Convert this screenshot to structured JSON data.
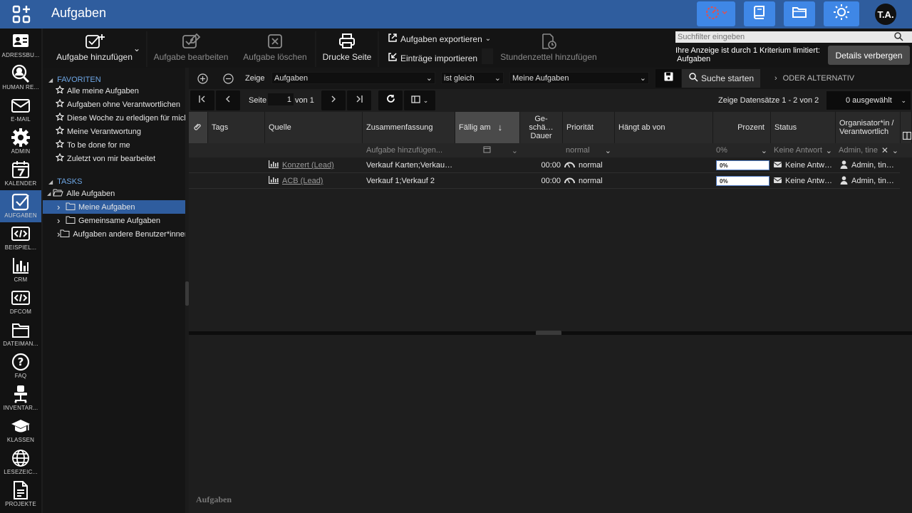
{
  "app": {
    "title": "Aufgaben",
    "user_initials": "T.A."
  },
  "topbar_icons": [
    "apps-grid-icon",
    "stopwatch-icon",
    "book-icon",
    "folder-icon",
    "brightness-icon"
  ],
  "nav": [
    {
      "label": "ADRESSBU...",
      "icon": "addressbook-icon"
    },
    {
      "label": "HUMAN RE...",
      "icon": "person-search-icon"
    },
    {
      "label": "E-MAIL",
      "icon": "mail-icon"
    },
    {
      "label": "ADMIN",
      "icon": "gear-icon"
    },
    {
      "label": "KALENDER",
      "icon": "calendar-icon"
    },
    {
      "label": "AUFGABEN",
      "icon": "task-check-icon",
      "active": true
    },
    {
      "label": "BEISPIEL...",
      "icon": "code-icon"
    },
    {
      "label": "CRM",
      "icon": "bar-chart-icon"
    },
    {
      "label": "DFCOM",
      "icon": "code-icon"
    },
    {
      "label": "DATEIMAN...",
      "icon": "folder-icon"
    },
    {
      "label": "FAQ",
      "icon": "question-icon"
    },
    {
      "label": "INVENTAR...",
      "icon": "chair-icon"
    },
    {
      "label": "KLASSEN",
      "icon": "graduation-cap-icon"
    },
    {
      "label": "LESEZEIC...",
      "icon": "globe-icon"
    },
    {
      "label": "PROJEKTE",
      "icon": "document-icon"
    }
  ],
  "toolbar": {
    "add": "Aufgabe hinzufügen",
    "edit": "Aufgabe bearbeiten",
    "delete": "Aufgabe löschen",
    "print": "Drucke Seite",
    "export": "Aufgaben exportieren",
    "import": "Einträge importieren",
    "timesheet": "Stundenzettel hinzufügen"
  },
  "search": {
    "placeholder": "Suchfilter eingeben",
    "note": "Ihre Anzeige ist durch 1 Kriterium limitiert:",
    "note_sub": "Aufgaben",
    "details_button": "Details verbergen"
  },
  "tree": {
    "favorites_header": "FAVORITEN",
    "favorites": [
      "Alle meine Aufgaben",
      "Aufgaben ohne Verantwortlichen",
      "Diese Woche zu erledigen für mich",
      "Meine Verantwortung",
      "To be done for me",
      "Zuletzt von mir bearbeitet"
    ],
    "tasks_header": "TASKS",
    "root": "Alle Aufgaben",
    "folders": [
      "Meine Aufgaben",
      "Gemeinsame Aufgaben",
      "Aufgaben andere Benutzer*innen"
    ]
  },
  "filter": {
    "show_label": "Zeige",
    "field": "Aufgaben",
    "operator": "ist gleich",
    "value": "Meine Aufgaben",
    "search_button": "Suche starten",
    "or_alternative": "ODER ALTERNATIV"
  },
  "pager": {
    "page_label": "Seite",
    "page": "1",
    "of_label": "von 1",
    "records": "Zeige Datensätze 1 - 2 von 2",
    "selected": "0 ausgewählt"
  },
  "columns": [
    "Tags",
    "Quelle",
    "Zusammenfassung",
    "Fällig am",
    "Ge-\nschä…\nDauer",
    "Priorität",
    "Hängt ab von",
    "Prozent",
    "Status",
    "Organisator*in /\nVerantwortlich"
  ],
  "grid_filter": {
    "summary_placeholder": "Aufgabe hinzufügen...",
    "priority": "normal",
    "percent": "0%",
    "status": "Keine Antwort",
    "organizer": "Admin, tine"
  },
  "rows": [
    {
      "source": "Konzert (Lead)",
      "summary": "Verkauf Karten;Verkau…",
      "duration": "00:00",
      "priority": "normal",
      "percent_label": "0%",
      "percent": 0,
      "status": "Keine Antw…",
      "organizer": "Admin, tin…"
    },
    {
      "source": "ACB (Lead)",
      "summary": "Verkauf 1;Verkauf 2",
      "duration": "00:00",
      "priority": "normal",
      "percent_label": "0%",
      "percent": 0,
      "status": "Keine Antw…",
      "organizer": "Admin, tin…"
    }
  ],
  "detail": {
    "title": "Aufgaben"
  }
}
